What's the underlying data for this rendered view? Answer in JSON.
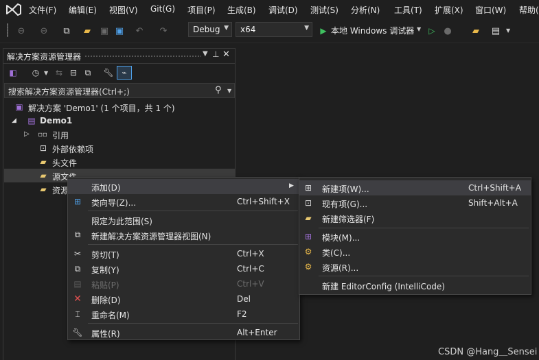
{
  "menu": [
    "文件(F)",
    "编辑(E)",
    "视图(V)",
    "Git(G)",
    "项目(P)",
    "生成(B)",
    "调试(D)",
    "测试(S)",
    "分析(N)",
    "工具(T)",
    "扩展(X)",
    "窗口(W)",
    "帮助("
  ],
  "toolbar": {
    "config": "Debug",
    "platform": "x64",
    "run_label": "本地 Windows 调试器"
  },
  "panel": {
    "title": "解决方案资源管理器",
    "search_placeholder": "搜索解决方案资源管理器(Ctrl+;)",
    "tree": {
      "solution": "解决方案 'Demo1' (1 个项目，共 1 个)",
      "project": "Demo1",
      "references": "引用",
      "external_deps": "外部依赖项",
      "header_files": "头文件",
      "source_files": "源文件",
      "resource_files": "资源"
    }
  },
  "context_menu": [
    {
      "label": "添加(D)",
      "shortcut": ""
    },
    {
      "label": "类向导(Z)...",
      "shortcut": "Ctrl+Shift+X"
    },
    {
      "label": "限定为此范围(S)",
      "shortcut": ""
    },
    {
      "label": "新建解决方案资源管理器视图(N)",
      "shortcut": ""
    },
    {
      "label": "剪切(T)",
      "shortcut": "Ctrl+X"
    },
    {
      "label": "复制(Y)",
      "shortcut": "Ctrl+C"
    },
    {
      "label": "粘贴(P)",
      "shortcut": "Ctrl+V"
    },
    {
      "label": "删除(D)",
      "shortcut": "Del"
    },
    {
      "label": "重命名(M)",
      "shortcut": "F2"
    },
    {
      "label": "属性(R)",
      "shortcut": "Alt+Enter"
    }
  ],
  "submenu": [
    {
      "label": "新建项(W)...",
      "shortcut": "Ctrl+Shift+A"
    },
    {
      "label": "现有项(G)...",
      "shortcut": "Shift+Alt+A"
    },
    {
      "label": "新建筛选器(F)",
      "shortcut": ""
    },
    {
      "label": "模块(M)...",
      "shortcut": ""
    },
    {
      "label": "类(C)...",
      "shortcut": ""
    },
    {
      "label": "资源(R)...",
      "shortcut": ""
    },
    {
      "label": "新建 EditorConfig (IntelliCode)",
      "shortcut": ""
    }
  ],
  "watermark": "CSDN @Hang＿Sensei",
  "colors": {
    "accent": "#4fa0e8",
    "highlight": "#3e3e42",
    "background": "#1f1f1f"
  }
}
